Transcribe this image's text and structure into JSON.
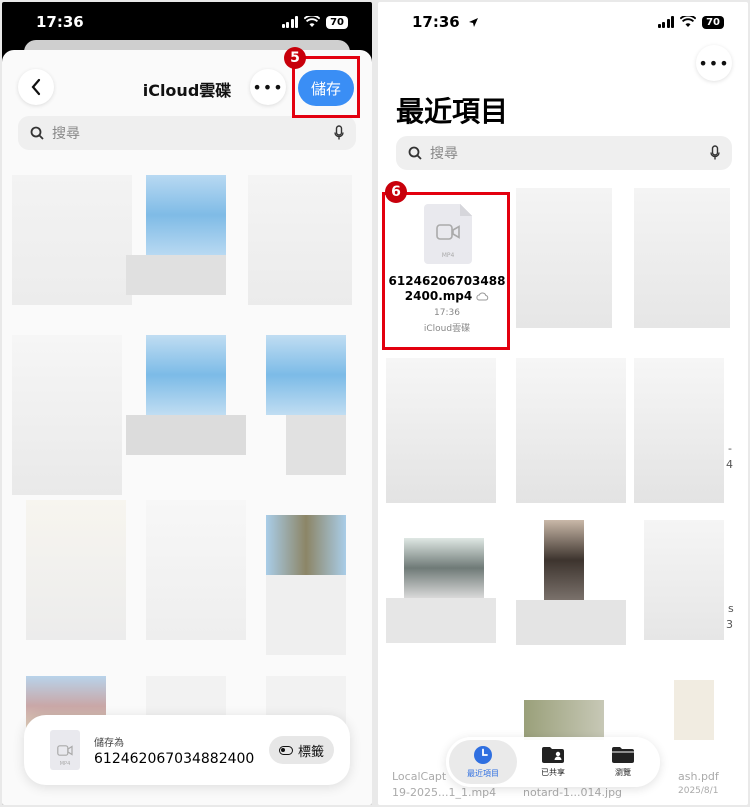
{
  "left": {
    "status": {
      "time": "17:36",
      "battery": "70"
    },
    "nav": {
      "title": "iCloud雲碟",
      "back_icon": "chevron-left-icon",
      "more_icon": "ellipsis-icon",
      "save_label": "儲存"
    },
    "annotation_5": "5",
    "search": {
      "placeholder": "搜尋"
    },
    "save_bar": {
      "label": "儲存為",
      "filename": "612462067034882400",
      "tags_label": "標籤"
    }
  },
  "right": {
    "status": {
      "time": "17:36",
      "battery": "70"
    },
    "title": "最近項目",
    "search": {
      "placeholder": "搜尋"
    },
    "annotation_6": "6",
    "highlighted_file": {
      "ext": "MP4",
      "name_line1": "61246206703488",
      "name_line2": "2400.mp4",
      "time": "17:36",
      "location": "iCloud雲碟"
    },
    "partial_labels": {
      "label_a": "LocalCapt",
      "label_b": "19-2025...1_1.mp4",
      "label_c": "notard-1...014.jpg",
      "label_d": "ash.pdf",
      "label_e": "2025/8/1",
      "label_f": "s",
      "label_g": "3",
      "label_h": "-",
      "label_i": "4"
    },
    "tabs": [
      {
        "label": "最近項目",
        "icon": "clock-icon",
        "active": true
      },
      {
        "label": "已共享",
        "icon": "shared-folder-icon",
        "active": false
      },
      {
        "label": "瀏覽",
        "icon": "folder-icon",
        "active": false
      }
    ]
  },
  "colors": {
    "accent": "#3a8ef5",
    "highlight": "#e3000f",
    "badge": "#c8000b"
  }
}
